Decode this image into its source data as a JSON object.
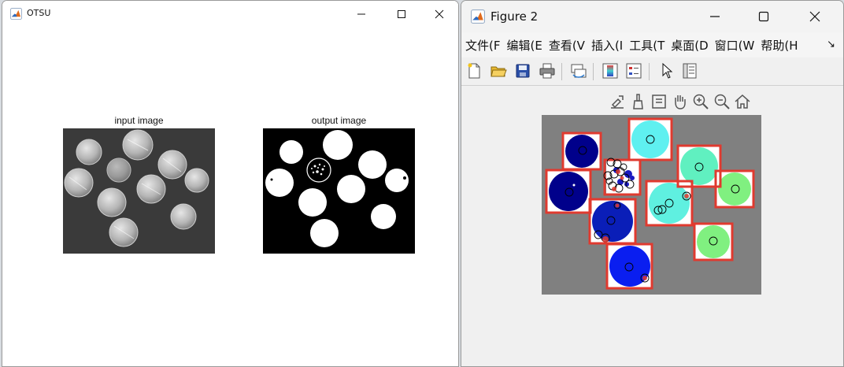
{
  "window_otsu": {
    "title": "OTSU",
    "axes": [
      {
        "title": "input image"
      },
      {
        "title": "output image"
      }
    ]
  },
  "window_figure": {
    "title": "Figure 2",
    "menu": [
      "文件(F",
      "编辑(E",
      "查看(V",
      "插入(I",
      "工具(T",
      "桌面(D",
      "窗口(W",
      "帮助(H"
    ],
    "menu_overflow_glyph": "↘",
    "toolbar_icons": [
      "new-figure-icon",
      "open-file-icon",
      "save-icon",
      "print-icon",
      "link-plot-icon",
      "colorbar-icon",
      "legend-icon",
      "edit-plot-icon",
      "property-inspector-icon"
    ],
    "axes_toolbar_icons": [
      "export-icon",
      "brush-icon",
      "datatip-icon",
      "pan-icon",
      "zoom-in-icon",
      "zoom-out-icon",
      "home-icon"
    ]
  },
  "colors": {
    "bbox_red": "#e03a2f",
    "navy": "#00008b",
    "blue": "#0a1ef0",
    "cyan": "#5ff0f0",
    "aqua_green": "#60f0c0",
    "light_green": "#80f080"
  }
}
